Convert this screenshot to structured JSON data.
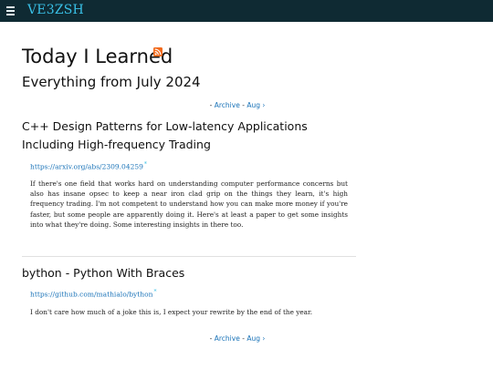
{
  "header": {
    "site_title": "VE3ZSH",
    "menu_icon": "hamburger-menu-icon",
    "background_color": "#0f2a33",
    "accent_color": "#39c0e6"
  },
  "page": {
    "title": "Today I Learned",
    "rss_icon": "rss-feed-icon",
    "subtitle": "Everything from July 2024"
  },
  "nav": {
    "prefix": "- ",
    "archive_label": "Archive",
    "separator": " - ",
    "next_label": "Aug ›"
  },
  "posts": [
    {
      "title": "C++ Design Patterns for Low-latency Applications Including High-frequency Trading",
      "link": "https://arxiv.org/abs/2309.04259",
      "link_marker": "*",
      "body": "If there's one field that works hard on understanding computer performance concerns but also has insane opsec to keep a near iron clad grip on the things they learn, it's high frequency trading. I'm not competent to understand how you can make more money if you're faster, but some people are apparently doing it. Here's at least a paper to get some insights into what they're doing. Some interesting insights in there too."
    },
    {
      "title": "bython - Python With Braces",
      "link": "https://github.com/mathialo/bython",
      "link_marker": "*",
      "body": "I don't care how much of a joke this is, I expect your rewrite by the end of the year."
    }
  ]
}
